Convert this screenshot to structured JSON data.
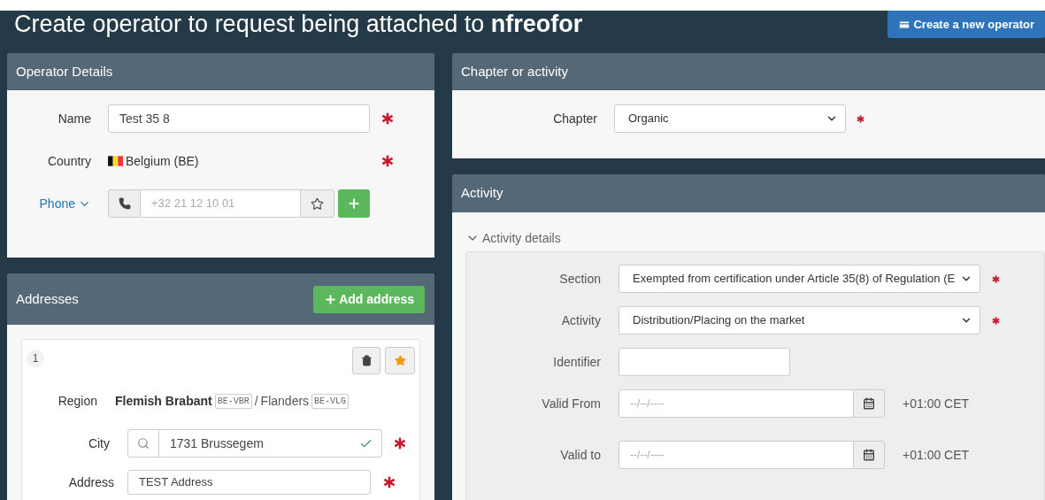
{
  "title": "Create operator to request being attached to **nfreofor**",
  "create_button": "Create a new operator",
  "operator_details": {
    "title": "Operator Details",
    "fields": [
      {
        "kind": "text",
        "label": "Name",
        "value": "Test 35 8",
        "required": true
      },
      {
        "kind": "country",
        "label": "Country",
        "value": "Belgium (BE)",
        "required": true
      },
      {
        "kind": "phone",
        "label": "Phone",
        "placeholder": "+32 21 12 10 01"
      }
    ]
  },
  "addresses": {
    "title": "Addresses",
    "add_button": "Add address",
    "items": [
      {
        "number": "1",
        "favorite": true,
        "region": {
          "label": "Region",
          "province": "Flemish Brabant",
          "province_code": "BE-VBR",
          "separator": "/",
          "name": "Flanders",
          "code": "BE-VLG"
        },
        "city": {
          "label": "City",
          "value": "1731 Brussegem",
          "valid": true,
          "required": true
        },
        "address": {
          "label": "Address",
          "value": "TEST Address",
          "required": true
        }
      }
    ]
  },
  "chapter": {
    "title": "Chapter or activity",
    "label": "Chapter",
    "value": "Organic",
    "required": true
  },
  "activity": {
    "title": "Activity",
    "details": {
      "title": "Activity details",
      "expanded": true,
      "fields": [
        {
          "kind": "select",
          "label": "Section",
          "value": "Exempted from certification under Article 35(8) of Regulation (E",
          "required": true
        },
        {
          "kind": "select",
          "label": "Activity",
          "value": "Distribution/Placing on the market",
          "required": true
        },
        {
          "kind": "text",
          "label": "Identifier"
        },
        {
          "kind": "date",
          "label": "Valid From",
          "placeholder": "--/--/----",
          "timezone": "+01:00 CET"
        },
        {
          "kind": "date",
          "label": "Valid to",
          "placeholder": "--/--/----",
          "timezone": "+01:00 CET"
        }
      ]
    }
  }
}
